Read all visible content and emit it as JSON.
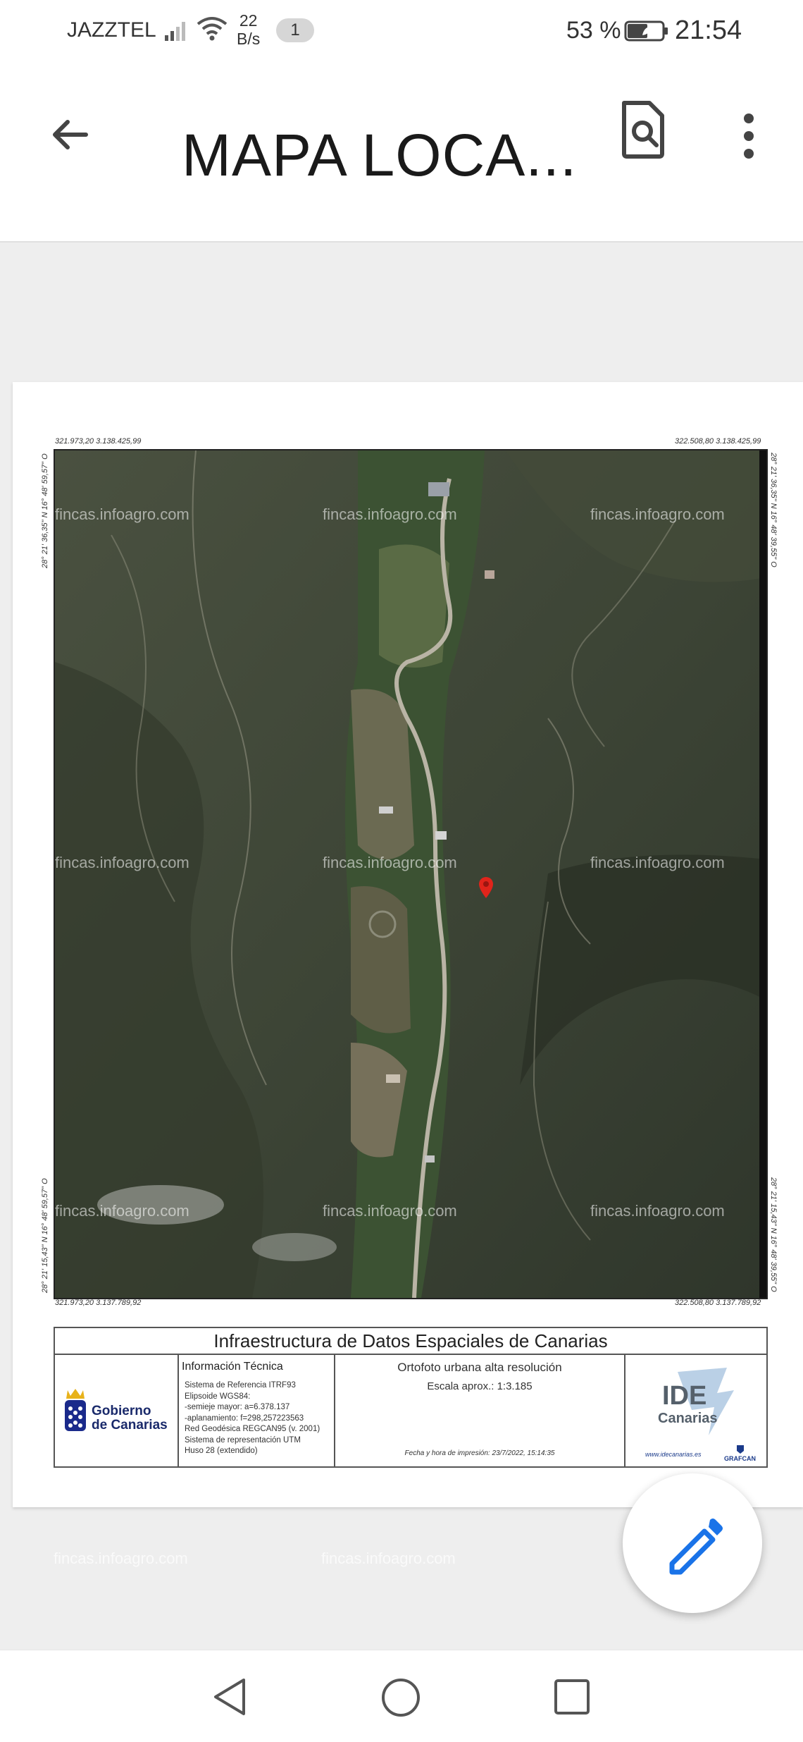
{
  "status_bar": {
    "carrier": "JAZZTEL",
    "speed_value": "22",
    "speed_unit": "B/s",
    "notification_count": "1",
    "battery_percent": "53 %",
    "time": "21:54"
  },
  "app_bar": {
    "title": "MAPA LOCA...",
    "back_icon": "arrow-back-icon",
    "find_icon": "find-in-page-icon",
    "more_icon": "more-vert-icon"
  },
  "document": {
    "coords": {
      "top_left": "321.973,20  3.138.425,99",
      "top_right": "322.508,80  3.138.425,99",
      "bottom_left": "321.973,20  3.137.789,92",
      "bottom_right": "322.508,80  3.137.789,92",
      "left_top_vertical": "28° 21' 36,35\" N  16° 48' 59,57\" O",
      "left_bottom_vertical": "28° 21' 15,43\" N  16° 48' 59,57\" O",
      "right_top_vertical": "28° 21' 36,35\" N  16° 48' 39,55\" O",
      "right_bottom_vertical": "28° 21' 15,43\" N  16° 48' 39,55\" O"
    },
    "watermark": "fincas.infoagro.com",
    "info_title": "Infraestructura de Datos Espaciales de Canarias",
    "gobierno_line1": "Gobierno",
    "gobierno_line2": "de Canarias",
    "tech_title": "Información Técnica",
    "tech_lines": [
      "Sistema de Referencia ITRF93",
      "Elipsoide WGS84:",
      "  -semieje mayor: a=6.378.137",
      "  -aplanamiento: f=298,257223563",
      "Red Geodésica REGCAN95 (v. 2001)",
      "Sistema de representación UTM",
      "Huso 28 (extendido)"
    ],
    "ortofoto": "Ortofoto urbana alta resolución",
    "escala": "Escala aprox.: 1:3.185",
    "fecha": "Fecha y hora de impresión:   23/7/2022, 15:14:35",
    "ide_line1": "IDE",
    "ide_line2": "Canarias",
    "ide_url": "www.idecanarias.es",
    "grafcan": "GRAFCAN"
  },
  "fab": {
    "icon": "edit-pencil-icon",
    "color": "#1a73e8"
  },
  "nav_bar": {
    "back_icon": "nav-back-icon",
    "home_icon": "nav-home-icon",
    "recents_icon": "nav-recents-icon"
  }
}
